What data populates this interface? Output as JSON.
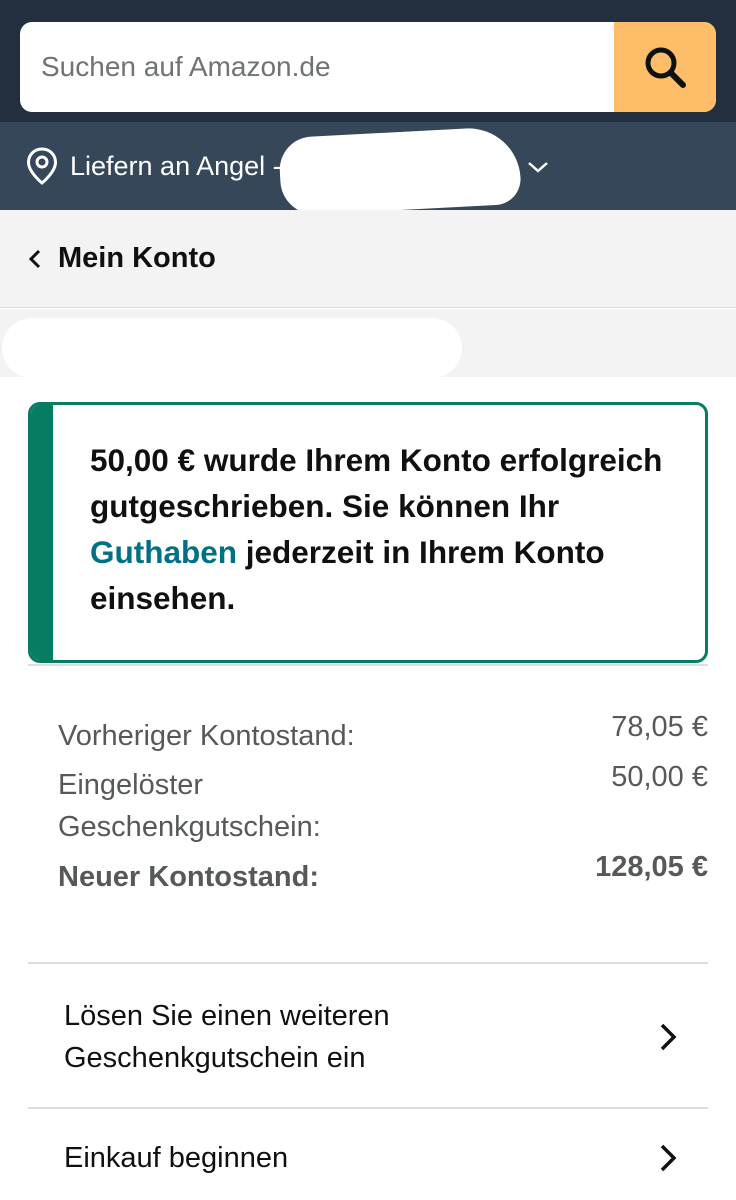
{
  "search": {
    "placeholder": "Suchen auf Amazon.de"
  },
  "icons": {
    "search": "search-icon",
    "location": "location-pin-icon",
    "chevron_down": "chevron-down-icon",
    "chevron_left": "chevron-left-icon",
    "chevron_right": "chevron-right-icon"
  },
  "delivery": {
    "label": "Liefern an Angel -"
  },
  "account": {
    "title": "Mein Konto"
  },
  "alert": {
    "text_before": "50,00 € wurde Ihrem Konto erfolgreich gutgeschrieben. Sie können Ihr",
    "link": "Guthaben",
    "text_after": "jederzeit in Ihrem Konto einsehen."
  },
  "balance": {
    "previous_label": "Vorheriger Kontostand:",
    "previous_value": "78,05 €",
    "redeemed_label": "Eingelöster Geschenkgutschein:",
    "redeemed_value": "50,00 €",
    "new_label": "Neuer Kontostand:",
    "new_value": "128,05 €"
  },
  "actions": {
    "redeem_another": "Lösen Sie einen weiteren Geschenkgutschein ein",
    "start_shopping": "Einkauf beginnen"
  },
  "colors": {
    "header": "#232f3e",
    "delivery_bar": "#37475a",
    "search_button": "#febd69",
    "success_green": "#067d62",
    "link_teal": "#007185"
  }
}
